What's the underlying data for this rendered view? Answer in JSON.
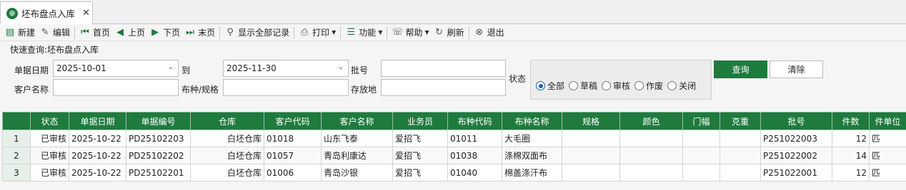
{
  "tab": {
    "title": "坯布盘点入库",
    "close": "✕"
  },
  "toolbar": {
    "new": "新建",
    "edit": "编辑",
    "first": "首页",
    "prev": "上页",
    "next": "下页",
    "last": "末页",
    "show_all": "显示全部记录",
    "print": "打印",
    "functions": "功能",
    "help": "帮助",
    "refresh": "刷新",
    "exit": "退出"
  },
  "quick_query": {
    "title": "快速查询:坯布盘点入库",
    "date_label": "单据日期",
    "date_from": "2025-10-01",
    "to_label": "到",
    "date_to": "2025-11-30",
    "batch_label": "批号",
    "batch_value": "",
    "customer_label": "客户名称",
    "customer_value": "",
    "fabric_label": "布种/规格",
    "fabric_value": "",
    "location_label": "存放地",
    "location_value": "",
    "status_label": "状态",
    "status_options": [
      "全部",
      "草稿",
      "审核",
      "作废",
      "关闭"
    ],
    "status_selected": "全部",
    "query_button": "查询",
    "clear_button": "清除"
  },
  "grid": {
    "columns": [
      "",
      "状态",
      "单据日期",
      "单据编号",
      "仓库",
      "客户代码",
      "客户名称",
      "业务员",
      "布种代码",
      "布种名称",
      "规格",
      "颜色",
      "门幅",
      "克重",
      "批号",
      "件数",
      "件单位"
    ],
    "rows": [
      [
        "1",
        "已审核",
        "2025-10-22",
        "PD25102203",
        "白坯仓库",
        "01018",
        "山东飞泰",
        "爱招飞",
        "01011",
        "大毛圈",
        "",
        "",
        "",
        "",
        "P251022003",
        "12",
        "匹"
      ],
      [
        "2",
        "已审核",
        "2025-10-22",
        "PD25102202",
        "白坯仓库",
        "01057",
        "青岛利康达",
        "爱招飞",
        "01038",
        "涤棉双面布",
        "",
        "",
        "",
        "",
        "P251022002",
        "14",
        "匹"
      ],
      [
        "3",
        "已审核",
        "2025-10-22",
        "PD25102201",
        "白坯仓库",
        "01006",
        "青岛沙银",
        "爱招飞",
        "01040",
        "棉盖涤汗布",
        "",
        "",
        "",
        "",
        "P251022001",
        "12",
        "匹"
      ]
    ]
  },
  "colors": {
    "accent": "#1f7a3e",
    "radio_selected": "#1a5fb4"
  }
}
